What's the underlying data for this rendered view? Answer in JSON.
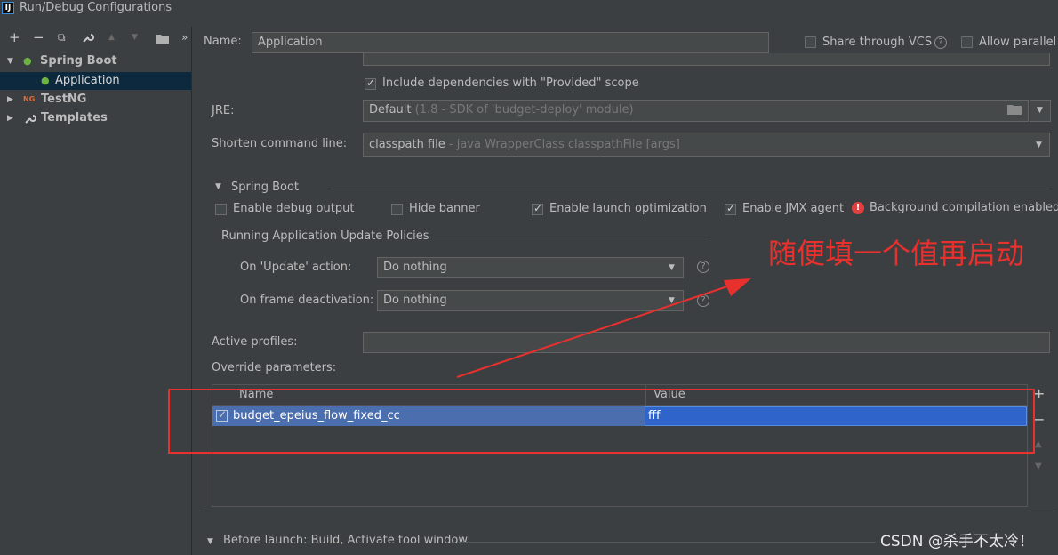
{
  "window": {
    "title": "Run/Debug Configurations"
  },
  "toolbar": {
    "add": "+",
    "remove": "−",
    "copy": "⧉",
    "wrench": "🔧",
    "up": "▲",
    "down": "▼",
    "folder": "📁",
    "more": "»"
  },
  "tree": {
    "items": [
      {
        "label": "Spring Boot",
        "expanded": true
      },
      {
        "label": "Application",
        "selected": true
      },
      {
        "label": "TestNG",
        "icon_text": "NG"
      },
      {
        "label": "Templates"
      }
    ]
  },
  "header": {
    "name_label": "Name:",
    "name_value": "Application",
    "share_label": "Share through VCS",
    "allow_parallel_label": "Allow parallel"
  },
  "form": {
    "include_provided_label": "Include dependencies with \"Provided\" scope",
    "jre_label": "JRE:",
    "jre_value": "Default",
    "jre_detail": "(1.8 - SDK of 'budget-deploy' module)",
    "shorten_label": "Shorten command line:",
    "shorten_value": "classpath file",
    "shorten_detail": "- java WrapperClass classpathFile [args]"
  },
  "spring_boot": {
    "section_label": "Spring Boot",
    "enable_debug_label": "Enable debug output",
    "hide_banner_label": "Hide banner",
    "launch_opt_label": "Enable launch optimization",
    "jmx_label": "Enable JMX agent",
    "bg_compilation_label": "Background compilation enabled",
    "policies_label": "Running Application Update Policies",
    "on_update_label": "On 'Update' action:",
    "on_update_value": "Do nothing",
    "on_frame_label": "On frame deactivation:",
    "on_frame_value": "Do nothing",
    "active_profiles_label": "Active profiles:",
    "override_label": "Override parameters:"
  },
  "table": {
    "columns": [
      "Name",
      "Value"
    ],
    "rows": [
      {
        "checked": true,
        "name": "budget_epeius_flow_fixed_cc",
        "value": "fff"
      }
    ]
  },
  "table_buttons": {
    "add": "+",
    "remove": "−",
    "up": "▲",
    "down": "▼"
  },
  "before_launch": {
    "label": "Before launch: Build, Activate tool window"
  },
  "annotation": {
    "text": "随便填一个值再启动",
    "color": "#e8302d"
  },
  "watermark": {
    "text": "CSDN @杀手不太冷！"
  }
}
